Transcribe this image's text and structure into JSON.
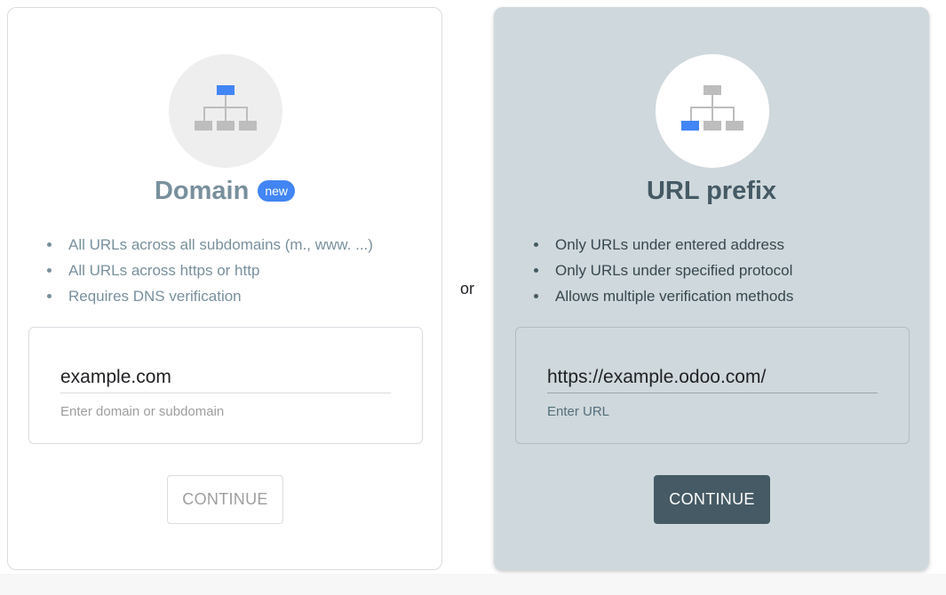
{
  "domain_card": {
    "title": "Domain",
    "badge": "new",
    "features": [
      "All URLs across all subdomains (m., www. ...)",
      "All URLs across https or http",
      "Requires DNS verification"
    ],
    "input_value": "example.com",
    "helper": "Enter domain or subdomain",
    "button_label": "CONTINUE",
    "icon": "sitemap-icon"
  },
  "separator": {
    "label": "or"
  },
  "url_card": {
    "title": "URL prefix",
    "features": [
      "Only URLs under entered address",
      "Only URLs under specified protocol",
      "Allows multiple verification methods"
    ],
    "input_value": "https://example.odoo.com/",
    "helper": "Enter URL",
    "button_label": "CONTINUE",
    "icon": "sitemap-icon"
  },
  "colors": {
    "accent_blue": "#4285f4",
    "icon_gray": "#bdbdbd",
    "url_card_bg": "#cfd8dc",
    "button_dark": "#455a64"
  }
}
